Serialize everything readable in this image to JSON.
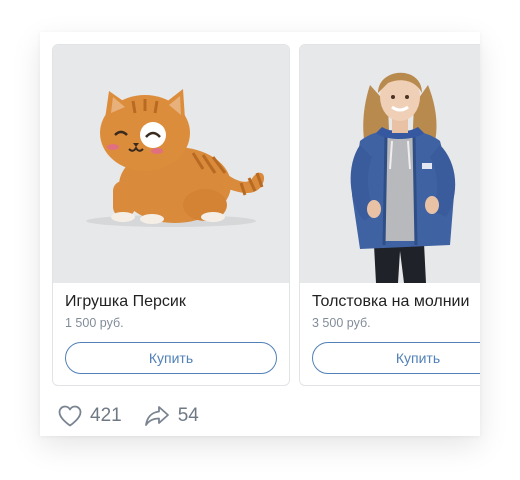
{
  "products": [
    {
      "title": "Игрушка Персик",
      "price": "1 500 руб.",
      "button": "Купить",
      "photo": "orange-cat-plush"
    },
    {
      "title": "Толстовка на молнии",
      "price": "3 500 руб.",
      "button": "Купить",
      "photo": "woman-in-blue-hoodie"
    }
  ],
  "actions": {
    "likes": "421",
    "shares": "54",
    "like_icon": "heart-icon",
    "share_icon": "share-arrow-icon"
  },
  "colors": {
    "accent": "#5181b8",
    "secondary_text": "#818c99",
    "photo_background": "#e7e8ea"
  }
}
